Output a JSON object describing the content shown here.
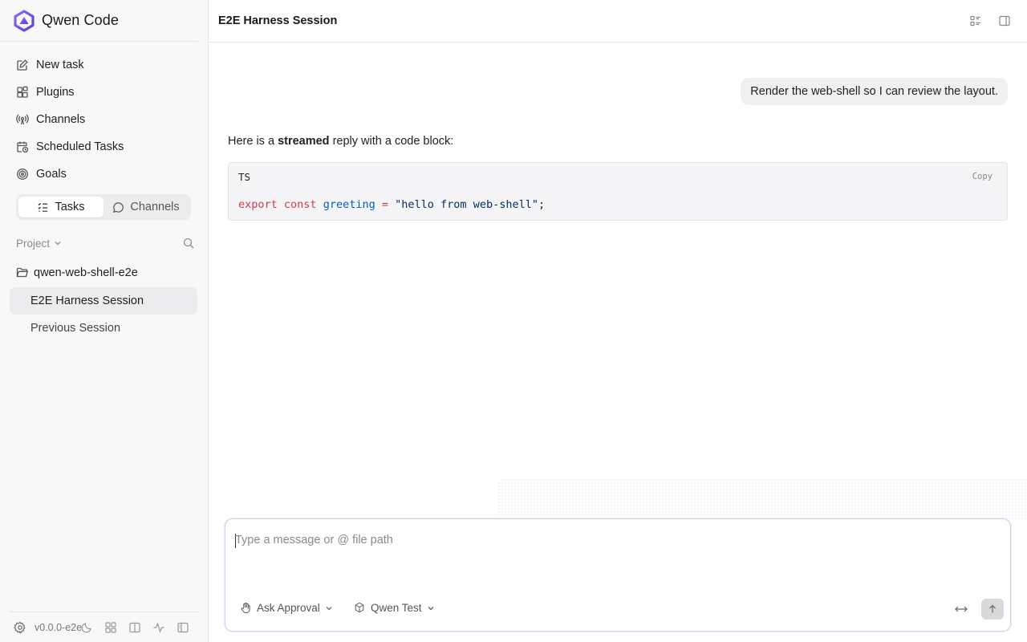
{
  "app": {
    "name": "Qwen Code",
    "version": "v0.0.0-e2e"
  },
  "sidebar": {
    "nav": [
      {
        "label": "New task",
        "icon": "edit-icon"
      },
      {
        "label": "Plugins",
        "icon": "plugins-icon"
      },
      {
        "label": "Channels",
        "icon": "broadcast-icon"
      },
      {
        "label": "Scheduled Tasks",
        "icon": "calendar-clock-icon"
      },
      {
        "label": "Goals",
        "icon": "target-icon"
      }
    ],
    "segmented": {
      "tasks_label": "Tasks",
      "channels_label": "Channels",
      "active": "Tasks"
    },
    "project_label": "Project",
    "folder_name": "qwen-web-shell-e2e",
    "sessions": [
      {
        "label": "E2E Harness Session",
        "active": true
      },
      {
        "label": "Previous Session",
        "active": false
      }
    ]
  },
  "header": {
    "title": "E2E Harness Session"
  },
  "conversation": {
    "user_message": "Render the web-shell so I can review the layout.",
    "assistant": {
      "prefix": "Here is a ",
      "bold": "streamed",
      "suffix": " reply with a code block:"
    },
    "code_block": {
      "language": "TS",
      "copy_label": "Copy",
      "tokens": {
        "kw1": "export",
        "kw2": "const",
        "name": "greeting",
        "op": "=",
        "str": "\"hello from web-shell\"",
        "end": ";"
      }
    }
  },
  "composer": {
    "placeholder": "Type a message or @ file path",
    "value": "",
    "approval_mode": "Ask Approval",
    "model": "Qwen Test"
  },
  "colors": {
    "accent": "#7c5cf0",
    "code_keyword": "#d73a49",
    "code_name": "#005cc5",
    "code_string": "#032f62"
  }
}
